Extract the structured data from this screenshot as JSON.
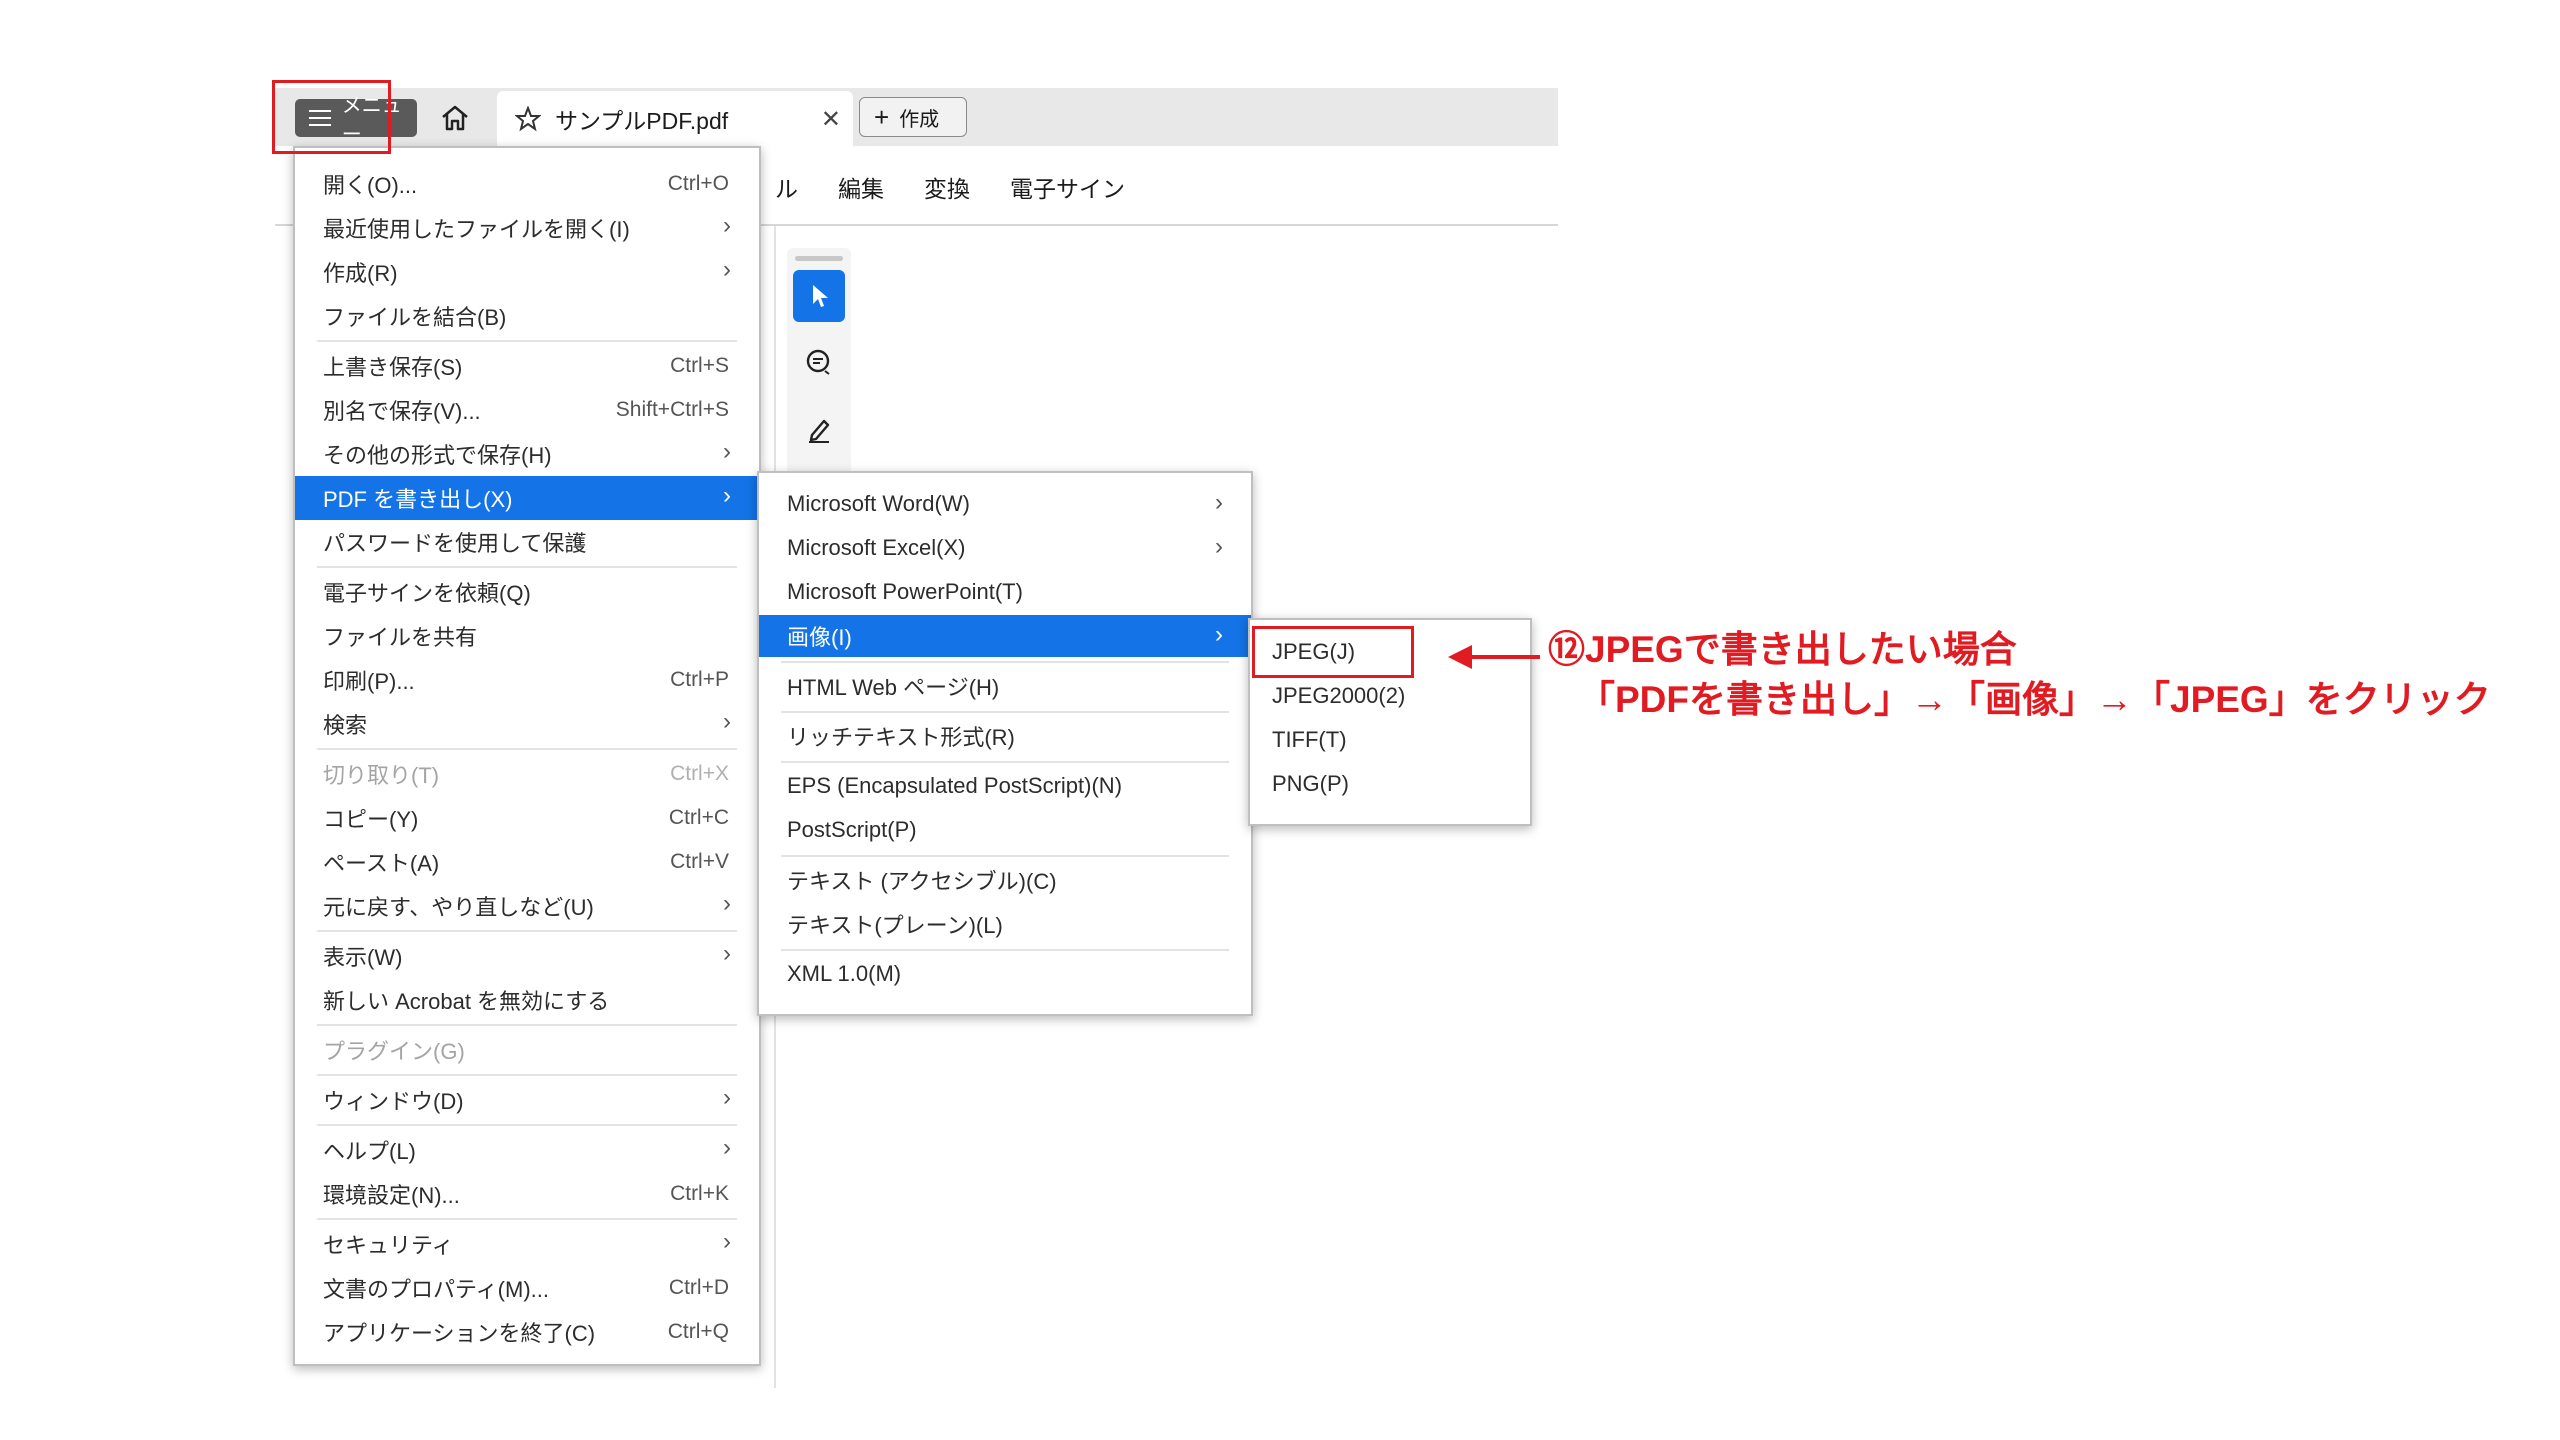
{
  "app": {
    "menu_button_label": "メニュー",
    "tab_title": "サンプルPDF.pdf",
    "create_label": "作成",
    "menubar": [
      "ル",
      "編集",
      "変換",
      "電子サイン"
    ]
  },
  "main_menu": [
    {
      "label": "開く(O)...",
      "shortcut": "Ctrl+O",
      "submenu": false,
      "disabled": false
    },
    {
      "label": "最近使用したファイルを開く(I)",
      "shortcut": "",
      "submenu": true,
      "disabled": false
    },
    {
      "label": "作成(R)",
      "shortcut": "",
      "submenu": true,
      "disabled": false
    },
    {
      "label": "ファイルを結合(B)",
      "shortcut": "",
      "submenu": false,
      "disabled": false
    },
    {
      "label": "上書き保存(S)",
      "shortcut": "Ctrl+S",
      "submenu": false,
      "disabled": false
    },
    {
      "label": "別名で保存(V)...",
      "shortcut": "Shift+Ctrl+S",
      "submenu": false,
      "disabled": false
    },
    {
      "label": "その他の形式で保存(H)",
      "shortcut": "",
      "submenu": true,
      "disabled": false
    },
    {
      "label": "PDF を書き出し(X)",
      "shortcut": "",
      "submenu": true,
      "disabled": false,
      "highlighted": true
    },
    {
      "label": "パスワードを使用して保護",
      "shortcut": "",
      "submenu": false,
      "disabled": false
    },
    {
      "label": "電子サインを依頼(Q)",
      "shortcut": "",
      "submenu": false,
      "disabled": false
    },
    {
      "label": "ファイルを共有",
      "shortcut": "",
      "submenu": false,
      "disabled": false
    },
    {
      "label": "印刷(P)...",
      "shortcut": "Ctrl+P",
      "submenu": false,
      "disabled": false
    },
    {
      "label": "検索",
      "shortcut": "",
      "submenu": true,
      "disabled": false
    },
    {
      "label": "切り取り(T)",
      "shortcut": "Ctrl+X",
      "submenu": false,
      "disabled": true
    },
    {
      "label": "コピー(Y)",
      "shortcut": "Ctrl+C",
      "submenu": false,
      "disabled": false
    },
    {
      "label": "ペースト(A)",
      "shortcut": "Ctrl+V",
      "submenu": false,
      "disabled": false
    },
    {
      "label": "元に戻す、やり直しなど(U)",
      "shortcut": "",
      "submenu": true,
      "disabled": false
    },
    {
      "label": "表示(W)",
      "shortcut": "",
      "submenu": true,
      "disabled": false
    },
    {
      "label": "新しい Acrobat を無効にする",
      "shortcut": "",
      "submenu": false,
      "disabled": false
    },
    {
      "label": "プラグイン(G)",
      "shortcut": "",
      "submenu": false,
      "disabled": true
    },
    {
      "label": "ウィンドウ(D)",
      "shortcut": "",
      "submenu": true,
      "disabled": false
    },
    {
      "label": "ヘルプ(L)",
      "shortcut": "",
      "submenu": true,
      "disabled": false
    },
    {
      "label": "環境設定(N)...",
      "shortcut": "Ctrl+K",
      "submenu": false,
      "disabled": false
    },
    {
      "label": "セキュリティ",
      "shortcut": "",
      "submenu": true,
      "disabled": false
    },
    {
      "label": "文書のプロパティ(M)...",
      "shortcut": "Ctrl+D",
      "submenu": false,
      "disabled": false
    },
    {
      "label": "アプリケーションを終了(C)",
      "shortcut": "Ctrl+Q",
      "submenu": false,
      "disabled": false
    }
  ],
  "export_menu": [
    {
      "label": "Microsoft Word(W)",
      "submenu": true
    },
    {
      "label": "Microsoft Excel(X)",
      "submenu": true
    },
    {
      "label": "Microsoft PowerPoint(T)",
      "submenu": false
    },
    {
      "label": "画像(I)",
      "submenu": true,
      "highlighted": true
    },
    {
      "label": "HTML Web ページ(H)",
      "submenu": false
    },
    {
      "label": "リッチテキスト形式(R)",
      "submenu": false
    },
    {
      "label": "EPS (Encapsulated PostScript)(N)",
      "submenu": false
    },
    {
      "label": "PostScript(P)",
      "submenu": false
    },
    {
      "label": "テキスト (アクセシブル)(C)",
      "submenu": false
    },
    {
      "label": "テキスト(プレーン)(L)",
      "submenu": false
    },
    {
      "label": "XML 1.0(M)",
      "submenu": false
    }
  ],
  "image_menu": [
    {
      "label": "JPEG(J)"
    },
    {
      "label": "JPEG2000(2)"
    },
    {
      "label": "TIFF(T)"
    },
    {
      "label": "PNG(P)"
    }
  ],
  "annotation": {
    "line1": "⑫JPEGで書き出したい場合",
    "line2": "「PDFを書き出し」→「画像」→「JPEG」をクリック"
  },
  "colors": {
    "accent": "#1473e6",
    "annotation_red": "#e01b22"
  }
}
